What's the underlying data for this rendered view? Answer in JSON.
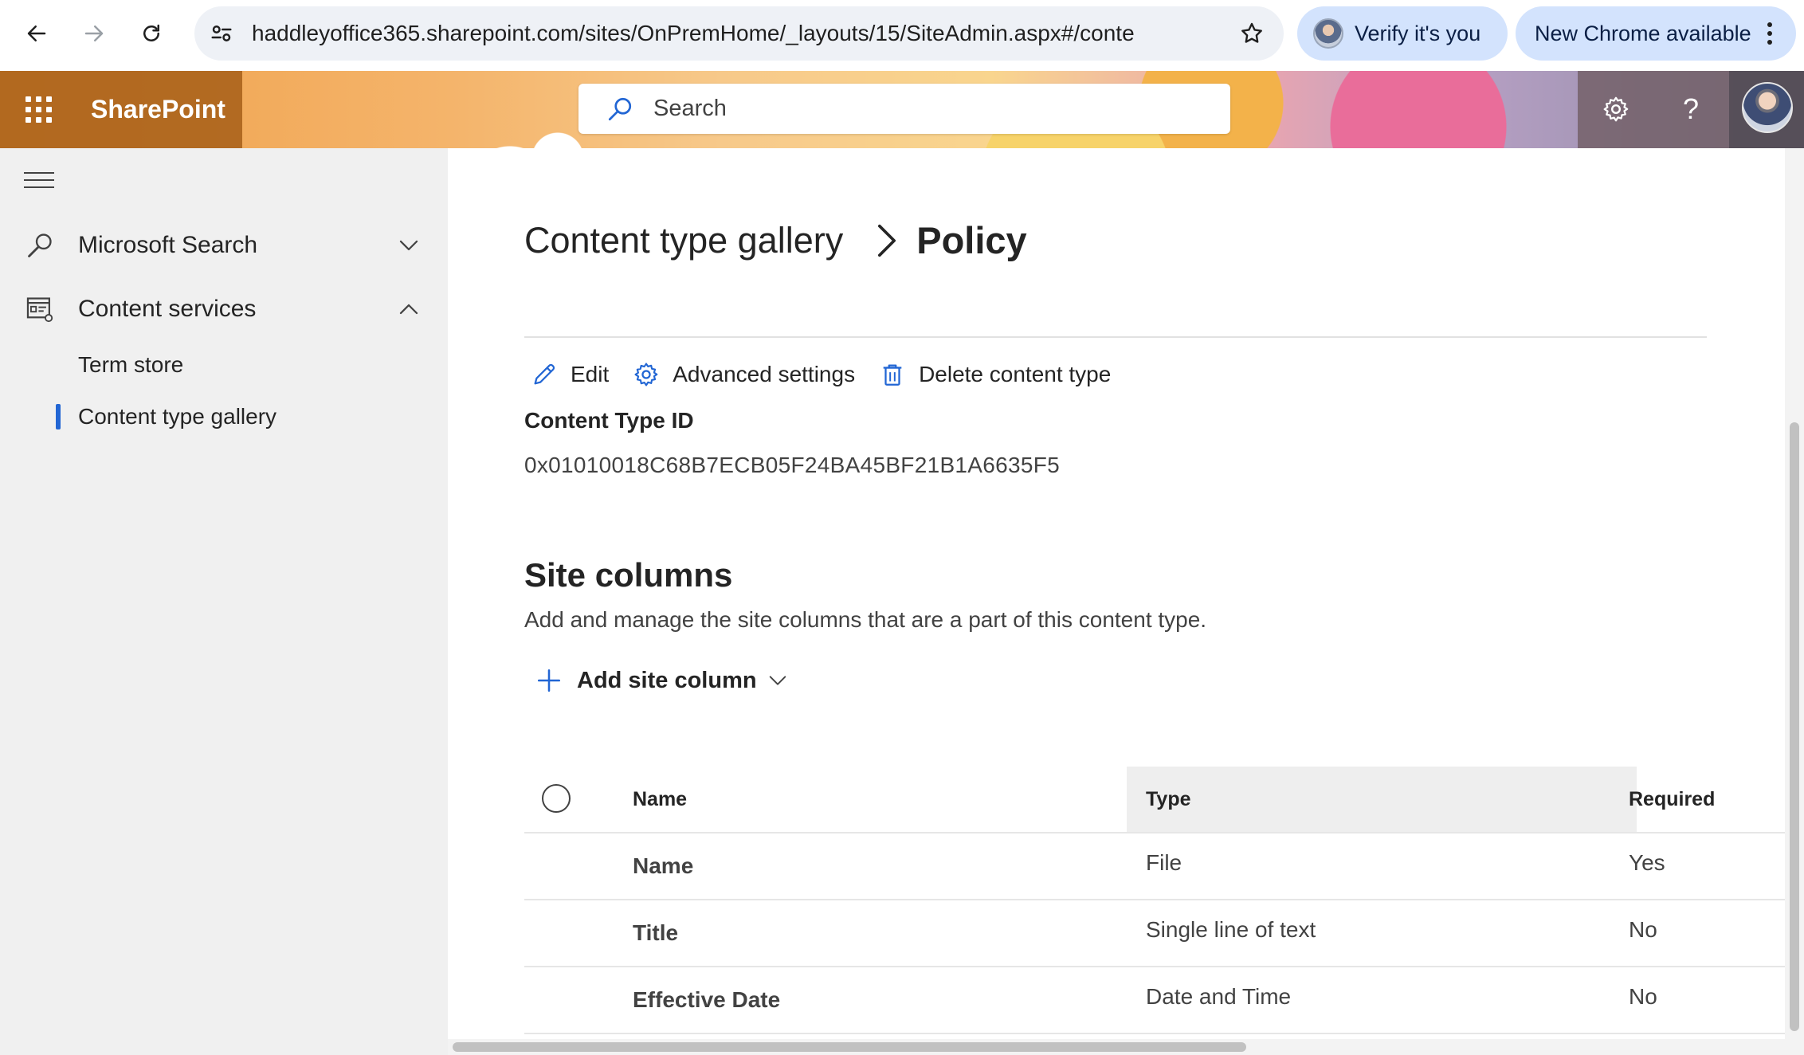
{
  "browser": {
    "url": "haddleyoffice365.sharepoint.com/sites/OnPremHome/_layouts/15/SiteAdmin.aspx#/conte...",
    "verify_label": "Verify it's you",
    "update_label": "New Chrome available"
  },
  "suitebar": {
    "brand": "SharePoint",
    "search_placeholder": "Search",
    "help_glyph": "?"
  },
  "leftnav": {
    "items": [
      {
        "label": "Microsoft Search",
        "icon": "search-icon",
        "expanded": false
      },
      {
        "label": "Content services",
        "icon": "content-services-icon",
        "expanded": true
      }
    ],
    "subitems": [
      {
        "label": "Term store",
        "selected": false
      },
      {
        "label": "Content type gallery",
        "selected": true
      }
    ]
  },
  "page": {
    "breadcrumb_parent": "Content type gallery",
    "breadcrumb_current": "Policy",
    "commands": {
      "edit": "Edit",
      "advanced": "Advanced settings",
      "delete": "Delete content type"
    },
    "content_type_id_label": "Content Type ID",
    "content_type_id": "0x01010018C68B7ECB05F24BA45BF21B1A6635F5",
    "site_columns_heading": "Site columns",
    "site_columns_desc": "Add and manage the site columns that are a part of this content type.",
    "add_site_column": "Add site column"
  },
  "table": {
    "headers": {
      "name": "Name",
      "type": "Type",
      "required": "Required"
    },
    "rows": [
      {
        "name": "Name",
        "type": "File",
        "required": "Yes"
      },
      {
        "name": "Title",
        "type": "Single line of text",
        "required": "No"
      },
      {
        "name": "Effective Date",
        "type": "Date and Time",
        "required": "No"
      }
    ]
  },
  "colors": {
    "accent": "#2266d4",
    "suite_left": "#a86019",
    "nav_bg": "#f0f0f0"
  }
}
